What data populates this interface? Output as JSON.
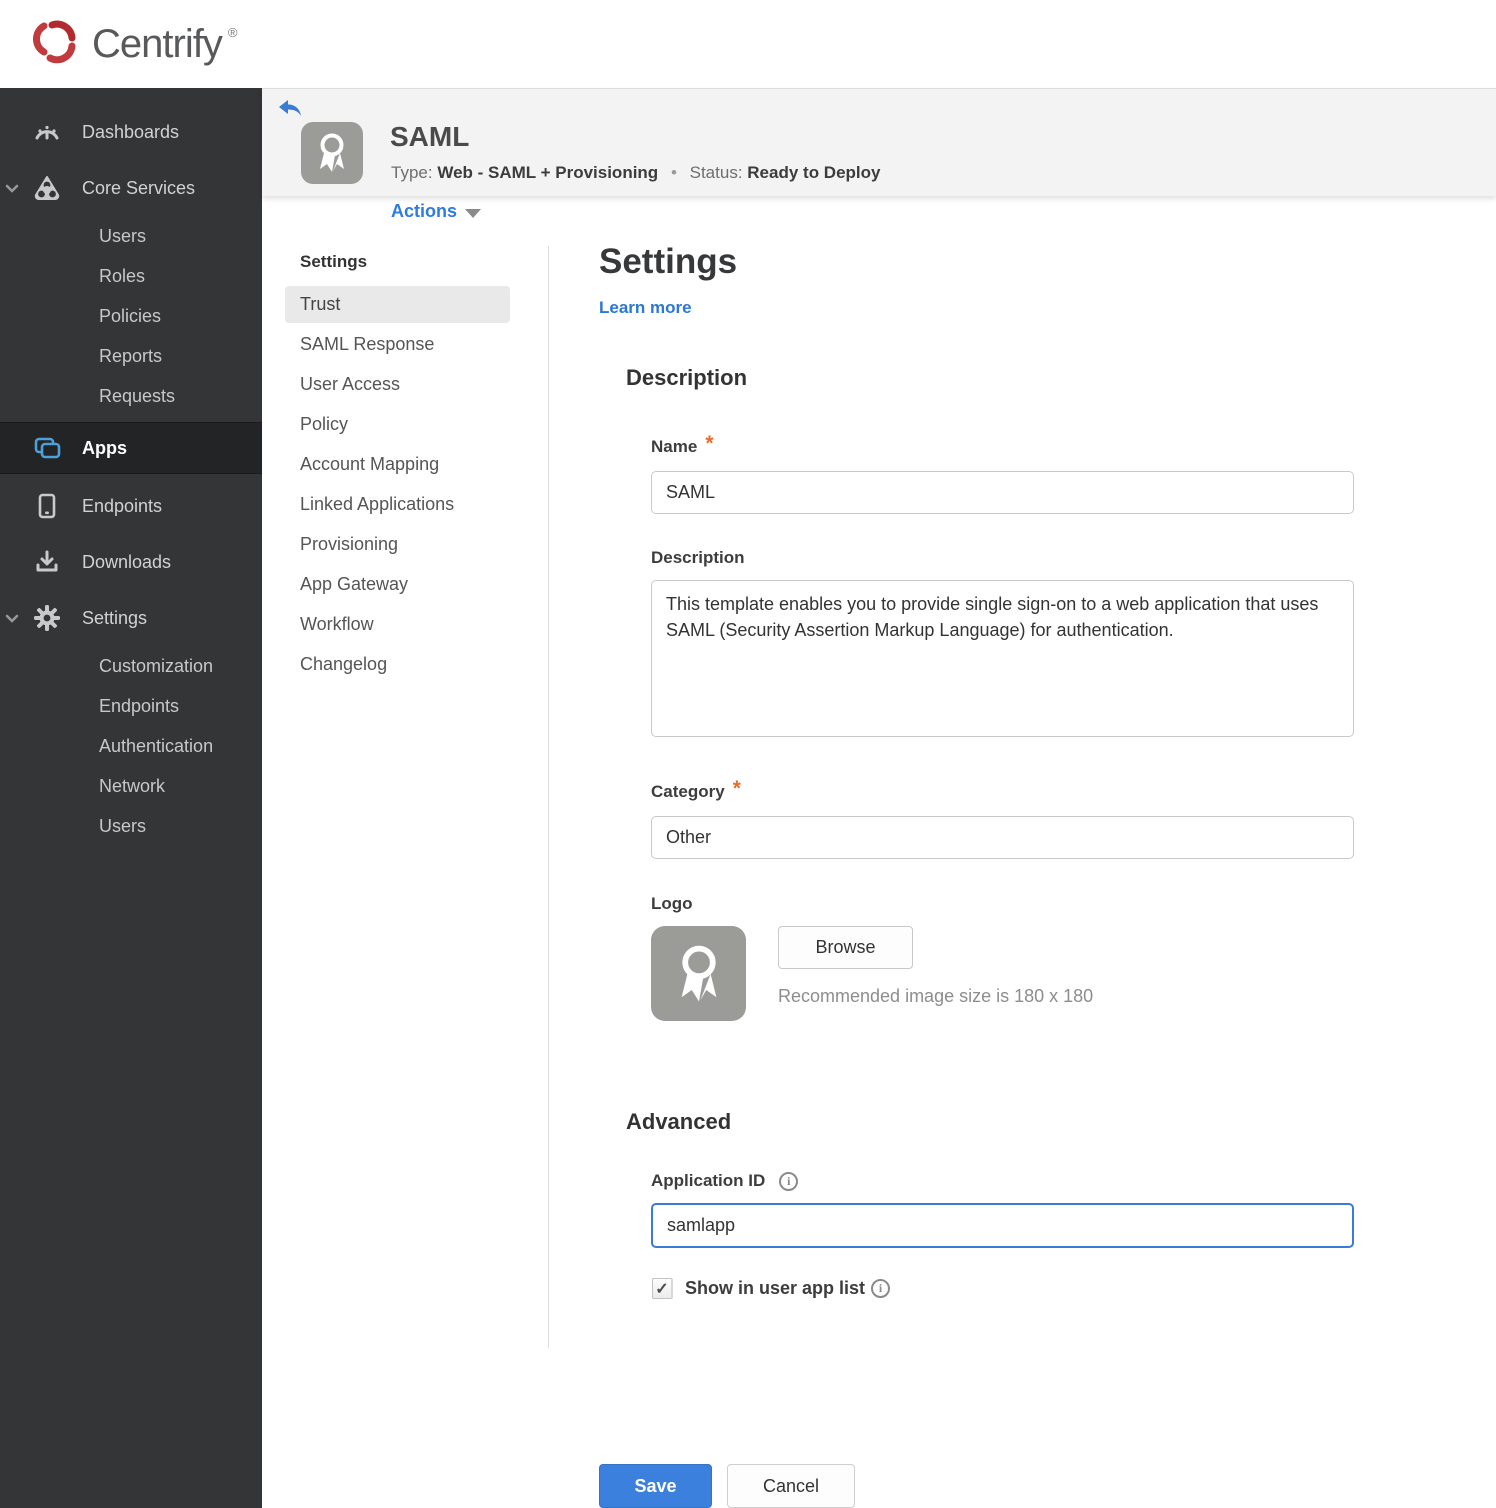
{
  "brand": {
    "name": "Centrify",
    "registered_mark": "®"
  },
  "colors": {
    "accent_blue": "#3b80dd",
    "brand_red": "#c13a3e",
    "status_red": "#a61e22",
    "required_orange": "#e96b2d",
    "sidebar_bg": "#343537",
    "header_bg": "#f3f3f4"
  },
  "sidebar": {
    "items": [
      {
        "label": "Dashboards",
        "icon": "gauge"
      },
      {
        "label": "Core Services",
        "icon": "core-services",
        "expanded": true,
        "children": [
          "Users",
          "Roles",
          "Policies",
          "Reports",
          "Requests"
        ]
      },
      {
        "label": "Apps",
        "icon": "apps",
        "active": true
      },
      {
        "label": "Endpoints",
        "icon": "device"
      },
      {
        "label": "Downloads",
        "icon": "download"
      },
      {
        "label": "Settings",
        "icon": "gear",
        "expanded": true,
        "children": [
          "Customization",
          "Endpoints",
          "Authentication",
          "Network",
          "Users"
        ]
      }
    ]
  },
  "header": {
    "title": "SAML",
    "type_label": "Type:",
    "type_value": "Web - SAML + Provisioning",
    "separator": "•",
    "status_label": "Status:",
    "status_value": "Ready to Deploy",
    "actions_label": "Actions"
  },
  "subnav": {
    "header": "Settings",
    "active_item": "Trust",
    "items": [
      "Trust",
      "SAML Response",
      "User Access",
      "Policy",
      "Account Mapping",
      "Linked Applications",
      "Provisioning",
      "App Gateway",
      "Workflow",
      "Changelog"
    ]
  },
  "main": {
    "title": "Settings",
    "learn_more": "Learn more",
    "description_section": {
      "heading": "Description",
      "name_label": "Name",
      "name_value": "SAML",
      "description_label": "Description",
      "description_value": "This template enables you to provide single sign-on to a web application that uses SAML (Security Assertion Markup Language) for authentication.",
      "category_label": "Category",
      "category_value": "Other",
      "logo_label": "Logo",
      "browse_label": "Browse",
      "logo_hint": "Recommended image size is 180 x 180"
    },
    "advanced_section": {
      "heading": "Advanced",
      "app_id_label": "Application ID",
      "app_id_value": "samlapp",
      "show_in_list_label": "Show in user app list",
      "show_in_list_checked": true
    },
    "save_label": "Save",
    "cancel_label": "Cancel"
  }
}
